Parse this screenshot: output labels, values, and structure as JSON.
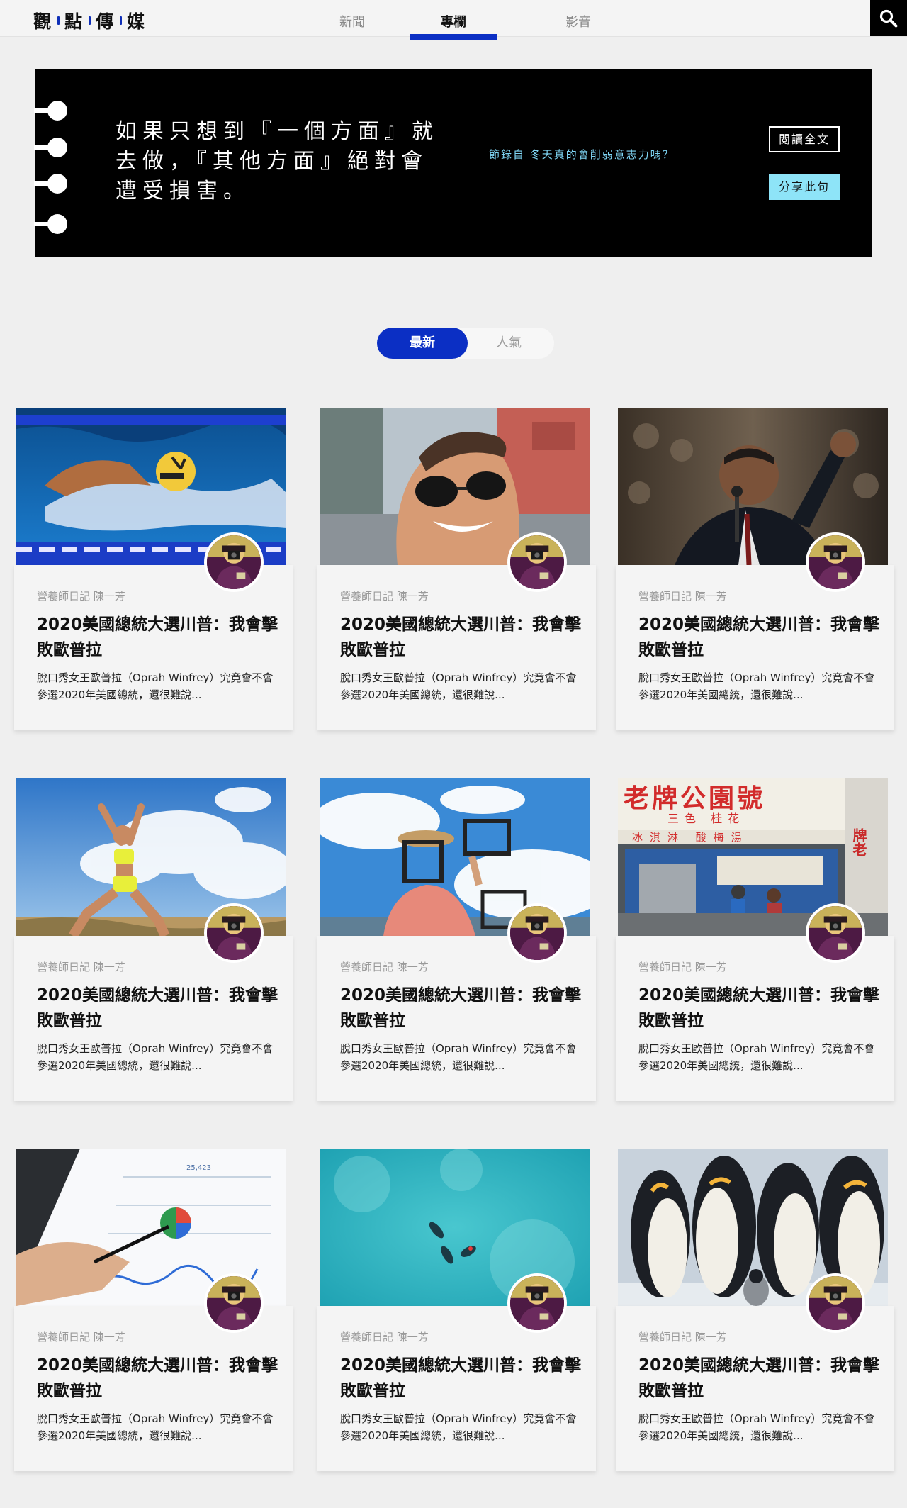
{
  "header": {
    "logo_chars": [
      "觀",
      "點",
      "傳",
      "媒"
    ],
    "tabs": [
      {
        "label": "新聞",
        "active": false
      },
      {
        "label": "專欄",
        "active": true
      },
      {
        "label": "影音",
        "active": false
      }
    ],
    "search_icon": "search-icon",
    "accent_color": "#0b2fc4"
  },
  "banner": {
    "quote_lines": [
      "如果只想到『一個方面』就",
      "去做，『其他方面』絕對會",
      "遭受損害。"
    ],
    "source": "節錄自 冬天真的會削弱意志力嗎？",
    "read_button": "閱讀全文",
    "share_button": "分享此句"
  },
  "sort_toggle": {
    "latest": "最新",
    "popular": "人氣",
    "selected": "最新"
  },
  "cards": [
    {
      "image": "swimmer",
      "category": "營養師日記",
      "author": "陳一芳",
      "title": "2020美國總統大選川普：我會擊敗歐普拉",
      "excerpt": "脫口秀女王歐普拉（Oprah Winfrey）究竟會不會參選2020年美國總統，還很難說..."
    },
    {
      "image": "man-sunglasses",
      "category": "營養師日記",
      "author": "陳一芳",
      "title": "2020美國總統大選川普：我會擊敗歐普拉",
      "excerpt": "脫口秀女王歐普拉（Oprah Winfrey）究竟會不會參選2020年美國總統，還很難說..."
    },
    {
      "image": "speaker",
      "category": "營養師日記",
      "author": "陳一芳",
      "title": "2020美國總統大選川普：我會擊敗歐普拉",
      "excerpt": "脫口秀女王歐普拉（Oprah Winfrey）究竟會不會參選2020年美國總統，還很難說..."
    },
    {
      "image": "yoga-woman",
      "category": "營養師日記",
      "author": "陳一芳",
      "title": "2020美國總統大選川普：我會擊敗歐普拉",
      "excerpt": "脫口秀女王歐普拉（Oprah Winfrey）究竟會不會參選2020年美國總統，還很難說..."
    },
    {
      "image": "frames-sky",
      "category": "營養師日記",
      "author": "陳一芳",
      "title": "2020美國總統大選川普：我會擊敗歐普拉",
      "excerpt": "脫口秀女王歐普拉（Oprah Winfrey）究竟會不會參選2020年美國總統，還很難說..."
    },
    {
      "image": "shop-front",
      "category": "營養師日記",
      "author": "陳一芳",
      "title": "2020美國總統大選川普：我會擊敗歐普拉",
      "excerpt": "脫口秀女王歐普拉（Oprah Winfrey）究竟會不會參選2020年美國總統，還很難說...",
      "sign": {
        "main": "老牌公園號",
        "sub1": "三色 桂花",
        "sub2": "冰淇淋 酸梅湯",
        "side": "牌老"
      }
    },
    {
      "image": "tablet-chart",
      "category": "營養師日記",
      "author": "陳一芳",
      "title": "2020美國總統大選川普：我會擊敗歐普拉",
      "excerpt": "脫口秀女王歐普拉（Oprah Winfrey）究竟會不會參選2020年美國總統，還很難說..."
    },
    {
      "image": "ocean-swimmers",
      "category": "營養師日記",
      "author": "陳一芳",
      "title": "2020美國總統大選川普：我會擊敗歐普拉",
      "excerpt": "脫口秀女王歐普拉（Oprah Winfrey）究竟會不會參選2020年美國總統，還很難說..."
    },
    {
      "image": "penguins",
      "category": "營養師日記",
      "author": "陳一芳",
      "title": "2020美國總統大選川普：我會擊敗歐普拉",
      "excerpt": "脫口秀女王歐普拉（Oprah Winfrey）究竟會不會參選2020年美國總統，還很難說..."
    }
  ]
}
